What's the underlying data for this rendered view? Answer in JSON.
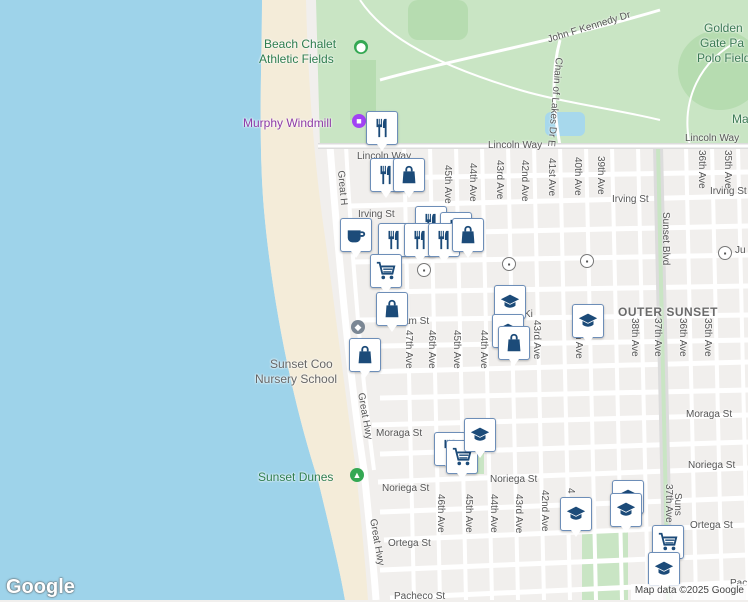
{
  "colors": {
    "water": "#9ed3ea",
    "beach": "#f4ecd9",
    "park": "#c9e5c4",
    "road": "#ffffff",
    "major_road": "#dcdcdc",
    "marker_icon": "#1c4b79"
  },
  "streets": {
    "lincoln_way_top": "Lincoln Way",
    "lincoln_way_right": "Lincoln Way",
    "john_f_kennedy_dr": "John F Kennedy Dr",
    "chain_of_lakes_dr": "Chain of Lakes Dr E",
    "irving_st": "Irving St",
    "irving_st_right": "Irving St",
    "judah_right": "Ju",
    "kirkham_st": "am St",
    "kirkham_st_2": "Ki",
    "moraga_st": "Moraga St",
    "moraga_st_right": "Moraga St",
    "noriega_st": "Noriega St",
    "noriega_st_right": "Noriega St",
    "ortega_st": "Ortega St",
    "ortega_st_right": "Ortega St",
    "pacheco_st": "Pacheco St",
    "pac_right": "Pac",
    "great_hwy_1": "Great H",
    "great_hwy_2": "Great Hwy",
    "great_hwy_3": "Great Hwy",
    "sunset_blvd": "Sunset Blvd",
    "sunset_blvd_2": "Suns",
    "ave_45th_a": "45th Ave",
    "ave_44th_a": "44th Ave",
    "ave_43rd_a": "43rd Ave",
    "ave_42nd_a": "42nd Ave",
    "ave_41st_a": "41st Ave",
    "ave_40th_a": "40th Ave",
    "ave_39th_a": "39th Ave",
    "ave_37th_a": "37th Ave",
    "ave_36th_a": "36th Ave",
    "ave_35th_a": "35th Ave",
    "ave_47th_b": "47th Ave",
    "ave_46th_b": "46th Ave",
    "ave_45th_b": "45th Ave",
    "ave_44th_b": "44th Ave",
    "ave_43rd_b": "43rd Ave",
    "ave_41st_b": "n Ave",
    "ave_38th_b": "38th Ave",
    "ave_37th_b": "37th Ave",
    "ave_36th_b": "36th Ave",
    "ave_35th_b": "35th Ave",
    "ave_46th_c": "46th Ave",
    "ave_45th_c": "45th Ave",
    "ave_44th_c": "44th Ave",
    "ave_43rd_c": "43rd Ave",
    "ave_42nd_c": "42nd Ave",
    "ave_37th_c": "37th Ave",
    "ave_4_c": "4"
  },
  "places": {
    "beach_chalet": "Beach Chalet\nAthletic Fields",
    "beach_chalet_1": "Beach Chalet",
    "beach_chalet_2": "Athletic Fields",
    "murphy_windmill": "Murphy Windmill",
    "golden_gate_1": "Golden",
    "golden_gate_2": "Gate Pa",
    "golden_gate_3": "Polo Field",
    "ma": "Ma",
    "outer_sunset": "OUTER SUNSET",
    "sunset_coop_1": "Sunset Coo",
    "sunset_coop_2": "Nursery School",
    "sunset_dunes": "Sunset Dunes"
  },
  "markers": [
    {
      "icon": "restaurant"
    },
    {
      "icon": "restaurant"
    },
    {
      "icon": "shopping-bag"
    },
    {
      "icon": "restaurant"
    },
    {
      "icon": "restaurant"
    },
    {
      "icon": "cafe"
    },
    {
      "icon": "restaurant"
    },
    {
      "icon": "restaurant"
    },
    {
      "icon": "restaurant"
    },
    {
      "icon": "shopping-bag"
    },
    {
      "icon": "grocery-cart"
    },
    {
      "icon": "shopping-bag"
    },
    {
      "icon": "school"
    },
    {
      "icon": "shopping-bag"
    },
    {
      "icon": "school"
    },
    {
      "icon": "shopping-bag"
    },
    {
      "icon": "school"
    },
    {
      "icon": "restaurant"
    },
    {
      "icon": "grocery-cart"
    },
    {
      "icon": "school"
    },
    {
      "icon": "school"
    },
    {
      "icon": "school"
    },
    {
      "icon": "grocery-cart"
    },
    {
      "icon": "school"
    },
    {
      "icon": "school"
    }
  ],
  "branding": {
    "logo": "Google",
    "attribution": "Map data ©2025 Google"
  }
}
